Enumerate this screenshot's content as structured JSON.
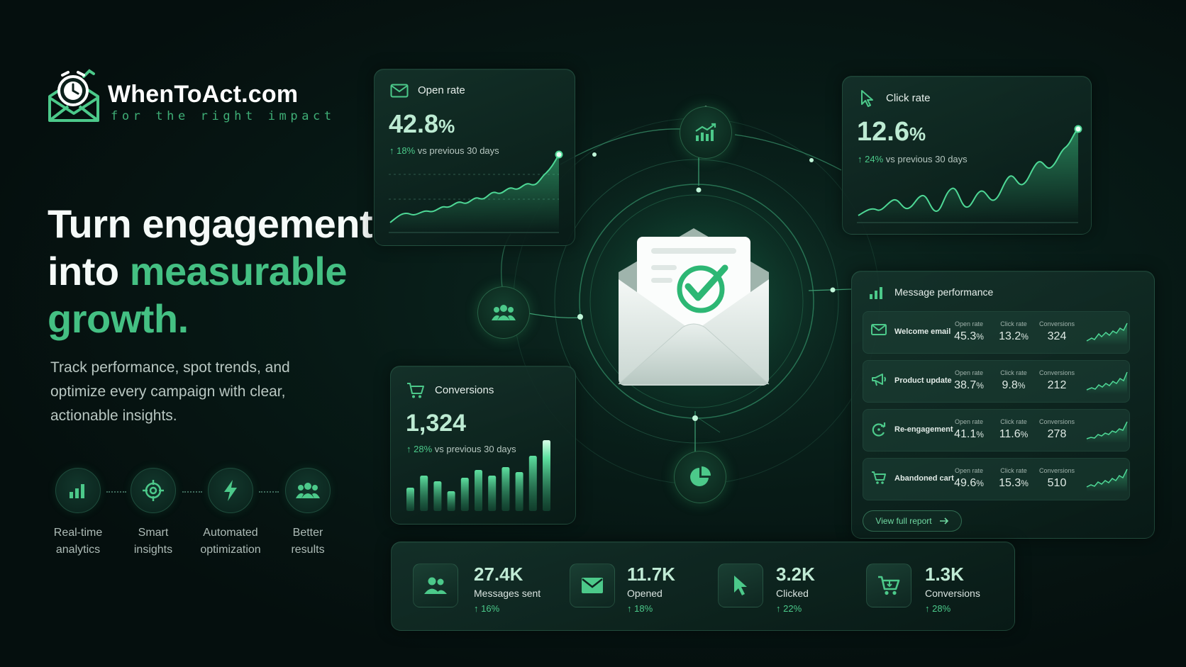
{
  "brand": {
    "name": "WhenToAct.com",
    "tagline": "for the right impact"
  },
  "hero": {
    "headline_line1": "Turn engagement",
    "headline_line2_plain": "into ",
    "headline_line2_accent": "measurable",
    "headline_line3_accent": "growth.",
    "subtext": "Track performance, spot trends, and optimize every campaign with clear, actionable insights."
  },
  "features": [
    {
      "line1": "Real-time",
      "line2": "analytics",
      "icon": "bar-chart-icon"
    },
    {
      "line1": "Smart",
      "line2": "insights",
      "icon": "target-icon"
    },
    {
      "line1": "Automated",
      "line2": "optimization",
      "icon": "lightning-icon"
    },
    {
      "line1": "Better",
      "line2": "results",
      "icon": "users-icon"
    }
  ],
  "open_rate": {
    "title": "Open rate",
    "value": "42.8",
    "unit": "%",
    "delta": "18%",
    "delta_text": " vs previous 30 days",
    "icon": "envelope-icon"
  },
  "click_rate": {
    "title": "Click rate",
    "value": "12.6",
    "unit": "%",
    "delta": "24%",
    "delta_text": " vs previous 30 days",
    "icon": "cursor-icon"
  },
  "conversions": {
    "title": "Conversions",
    "value": "1,324",
    "delta": "28%",
    "delta_text": " vs previous 30 days",
    "icon": "cart-icon",
    "bars": [
      0.33,
      0.5,
      0.42,
      0.28,
      0.47,
      0.58,
      0.5,
      0.62,
      0.55,
      0.78,
      1.0
    ]
  },
  "performance": {
    "title": "Message performance",
    "col_open": "Open rate",
    "col_click": "Click rate",
    "col_conv": "Conversions",
    "rows": [
      {
        "name": "Welcome email",
        "open": "45.3",
        "click": "13.2",
        "conv": "324",
        "icon": "envelope-icon"
      },
      {
        "name": "Product update",
        "open": "38.7",
        "click": "9.8",
        "conv": "212",
        "icon": "megaphone-icon"
      },
      {
        "name": "Re-engagement",
        "open": "41.1",
        "click": "11.6",
        "conv": "278",
        "icon": "refresh-icon"
      },
      {
        "name": "Abandoned cart",
        "open": "49.6",
        "click": "15.3",
        "conv": "510",
        "icon": "cart-icon"
      }
    ],
    "pct": "%",
    "report_label": "View full report"
  },
  "stats": [
    {
      "value": "27.4K",
      "label": "Messages sent",
      "delta": "16%",
      "icon": "users-icon"
    },
    {
      "value": "11.7K",
      "label": "Opened",
      "delta": "18%",
      "icon": "envelope-icon"
    },
    {
      "value": "3.2K",
      "label": "Clicked",
      "delta": "22%",
      "icon": "cursor-icon"
    },
    {
      "value": "1.3K",
      "label": "Conversions",
      "delta": "28%",
      "icon": "cart-icon"
    }
  ],
  "arrow": "↑",
  "colors": {
    "accent": "#44c083",
    "accent_bright": "#4bc98a",
    "background": "#071a16"
  }
}
